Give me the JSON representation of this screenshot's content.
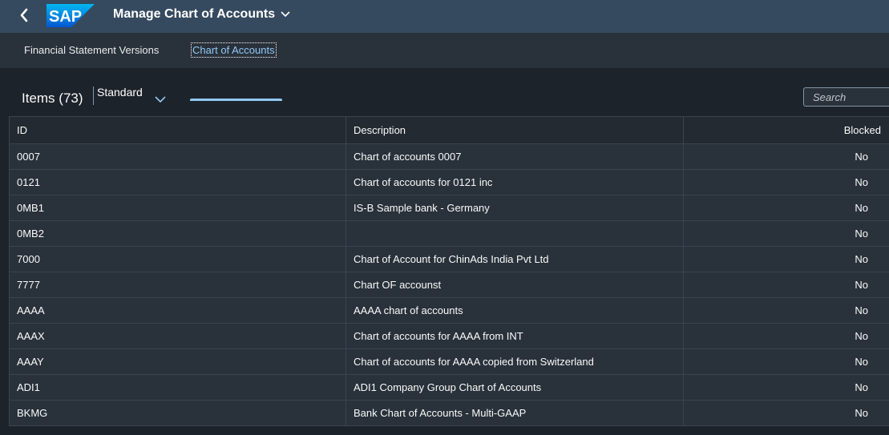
{
  "shell": {
    "back_label": "Back",
    "logo_text": "SAP",
    "app_title": "Manage Chart of Accounts",
    "brand_color": "#0070f2"
  },
  "tabs": [
    {
      "label": "Financial Statement Versions",
      "selected": false
    },
    {
      "label": "Chart of Accounts",
      "selected": true
    }
  ],
  "toolbar": {
    "items_title": "Items (73)",
    "variant": "Standard",
    "search_placeholder": "Search"
  },
  "table": {
    "columns": [
      "ID",
      "Description",
      "Blocked"
    ],
    "rows": [
      {
        "id": "0007",
        "description": "Chart of accounts 0007",
        "blocked": "No"
      },
      {
        "id": "0121",
        "description": "Chart of accounts for 0121 inc",
        "blocked": "No"
      },
      {
        "id": "0MB1",
        "description": "IS-B Sample bank - Germany",
        "blocked": "No"
      },
      {
        "id": "0MB2",
        "description": "",
        "blocked": "No"
      },
      {
        "id": "7000",
        "description": "Chart of Account for ChinAds India Pvt Ltd",
        "blocked": "No"
      },
      {
        "id": "7777",
        "description": "Chart OF accounst",
        "blocked": "No"
      },
      {
        "id": "AAAA",
        "description": "AAAA chart of accounts",
        "blocked": "No"
      },
      {
        "id": "AAAX",
        "description": "Chart of accounts for AAAA from INT",
        "blocked": "No"
      },
      {
        "id": "AAAY",
        "description": "Chart of accounts for AAAA copied from Switzerland",
        "blocked": "No"
      },
      {
        "id": "ADI1",
        "description": "ADI1 Company Group Chart of Accounts",
        "blocked": "No"
      },
      {
        "id": "BKMG",
        "description": "Bank Chart of Accounts - Multi-GAAP",
        "blocked": "No"
      }
    ]
  }
}
